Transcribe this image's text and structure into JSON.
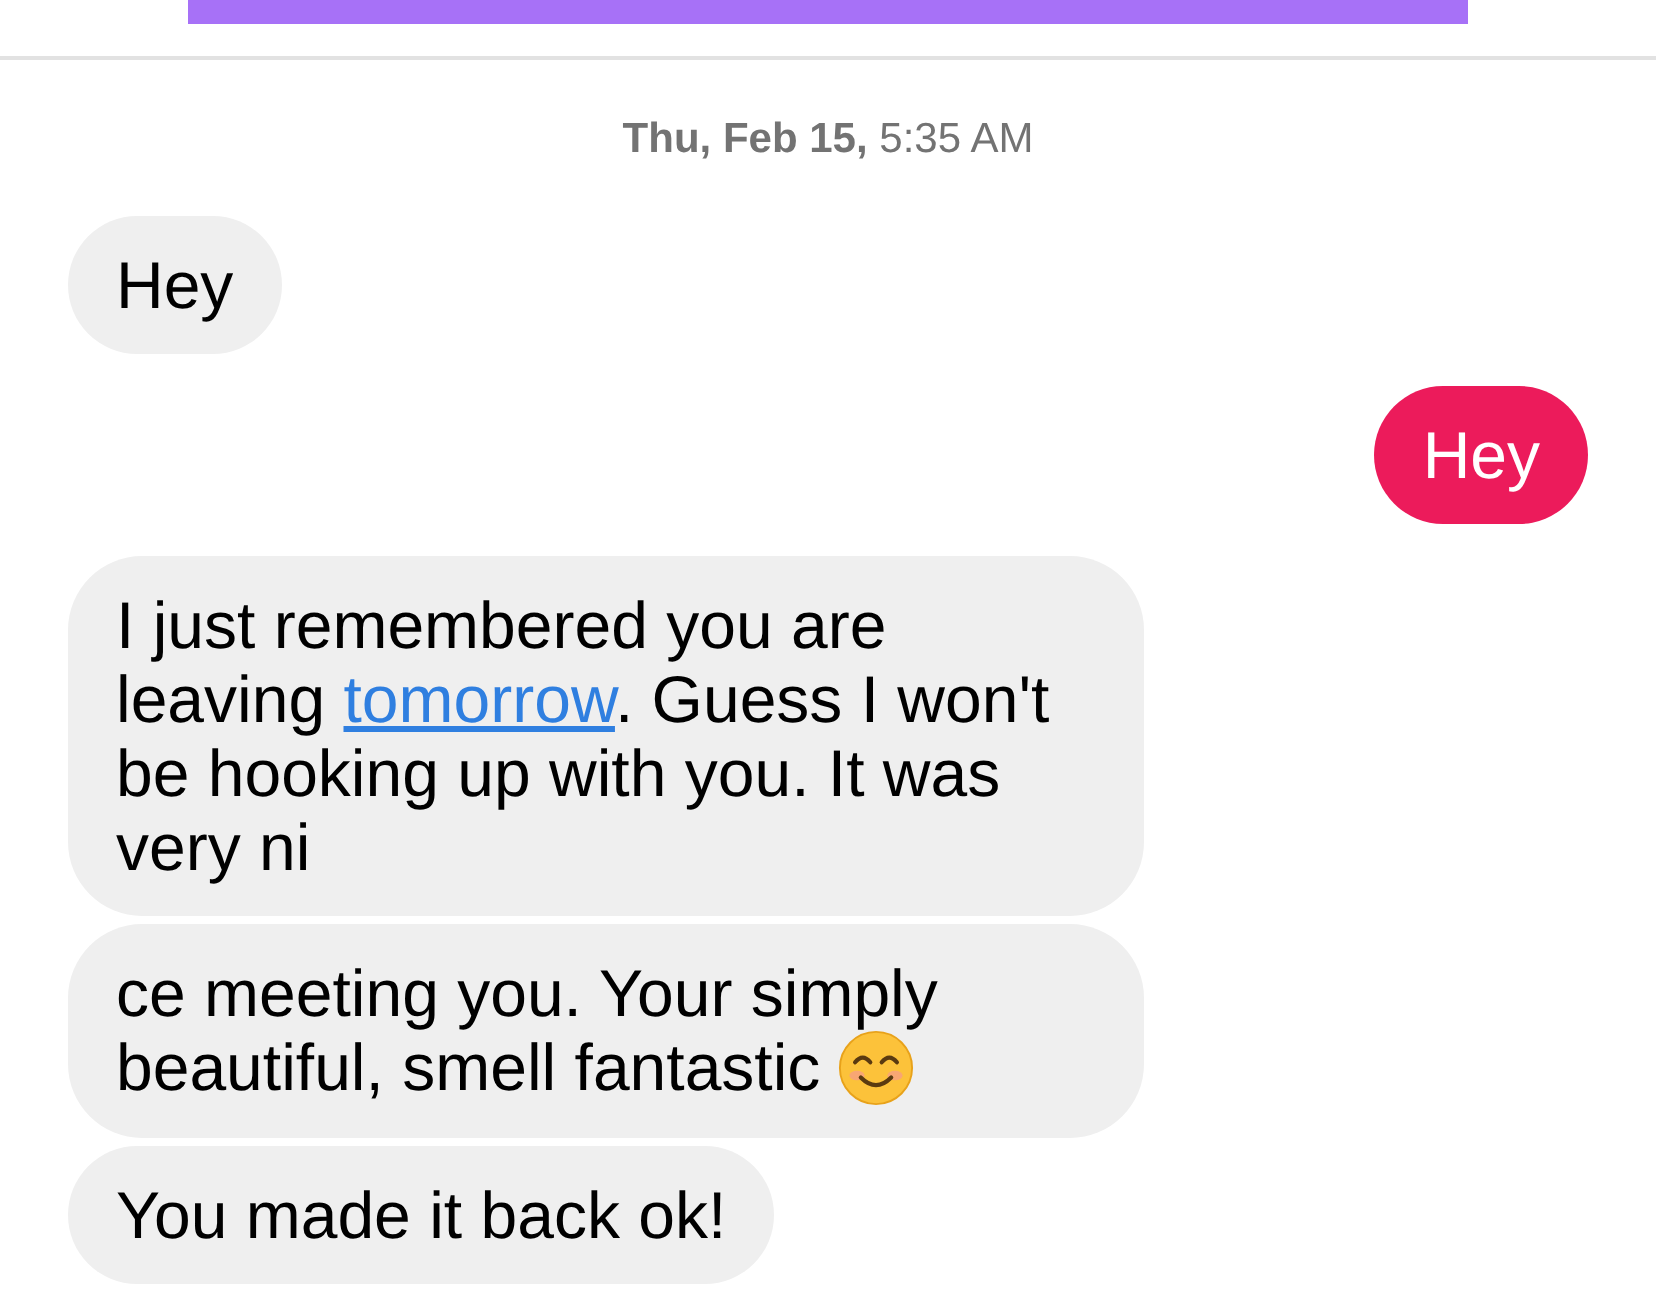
{
  "header": {
    "banner": true
  },
  "timestamp": "**Thu, Feb 15,** 5:35 AM",
  "messages": [
    {
      "kind": "received",
      "parts": [
        {
          "kind": "text",
          "text": "Hey"
        }
      ]
    },
    {
      "kind": "sent",
      "parts": [
        {
          "kind": "text",
          "text": "Hey"
        }
      ]
    },
    {
      "kind": "received",
      "parts": [
        {
          "kind": "text",
          "text": "I just remembered you are leaving "
        },
        {
          "kind": "link",
          "text": "tomorrow"
        },
        {
          "kind": "text",
          "text": ". Guess I won't be hooking up with you. It was very ni"
        }
      ]
    },
    {
      "kind": "received",
      "parts": [
        {
          "kind": "text",
          "text": "ce meeting you. Your simply beautiful, smell fantastic "
        },
        {
          "kind": "emoji"
        }
      ]
    },
    {
      "kind": "received",
      "parts": [
        {
          "kind": "text",
          "text": "You made it back ok!"
        }
      ]
    }
  ]
}
